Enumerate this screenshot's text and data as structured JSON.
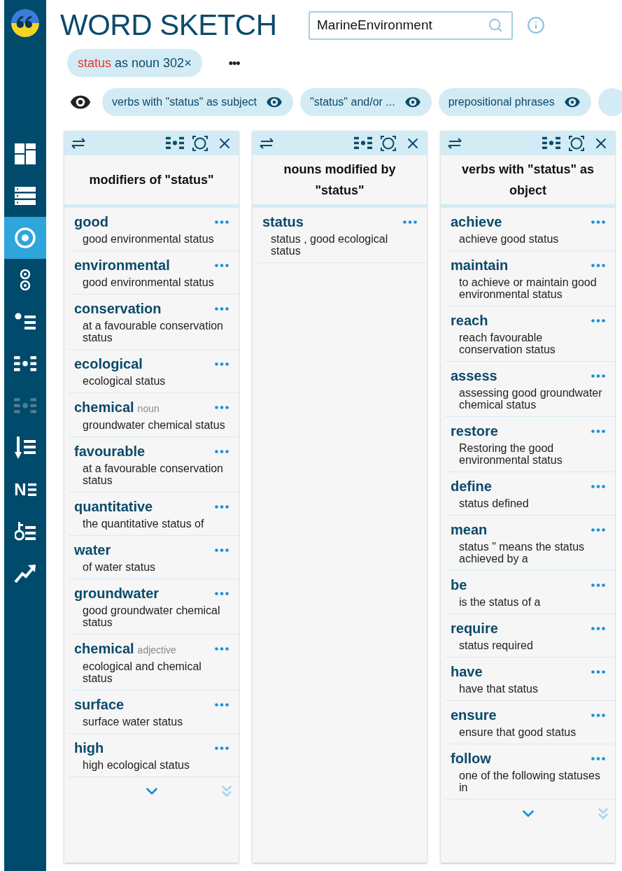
{
  "app": {
    "title": "WORD SKETCH"
  },
  "search": {
    "value": "MarineEnvironment"
  },
  "sidebar": {
    "items": [
      {
        "kind": "dashboard",
        "selected": false,
        "disabled": false
      },
      {
        "kind": "concordance",
        "selected": false,
        "disabled": false
      },
      {
        "kind": "wordsketch",
        "selected": true,
        "disabled": false
      },
      {
        "kind": "difference",
        "selected": false,
        "disabled": false
      },
      {
        "kind": "thesaurus",
        "selected": false,
        "disabled": false
      },
      {
        "kind": "wordlist",
        "selected": false,
        "disabled": false
      },
      {
        "kind": "wordlist",
        "selected": false,
        "disabled": true
      },
      {
        "kind": "sort",
        "selected": false,
        "disabled": false
      },
      {
        "kind": "letters",
        "label": "N",
        "selected": false,
        "disabled": false
      },
      {
        "kind": "keywords",
        "selected": false,
        "disabled": false
      },
      {
        "kind": "trends",
        "selected": false,
        "disabled": false
      }
    ]
  },
  "query": {
    "lemma": "status",
    "rest": "as noun 302×",
    "menu": "•••"
  },
  "chips": [
    {
      "label": "verbs with \"status\" as subject"
    },
    {
      "label": "\"status\" and/or ..."
    },
    {
      "label": "prepositional phrases"
    }
  ],
  "columns": [
    {
      "title": "modifiers of \"status\"",
      "has_more": true,
      "items": [
        {
          "word": "good",
          "example": "good environmental status"
        },
        {
          "word": "environmental",
          "example": "good environmental status"
        },
        {
          "word": "conservation",
          "example": "at a favourable conservation status"
        },
        {
          "word": "ecological",
          "example": "ecological status"
        },
        {
          "word": "chemical",
          "pos": "noun",
          "example": "groundwater chemical status"
        },
        {
          "word": "favourable",
          "example": "at a favourable conservation status"
        },
        {
          "word": "quantitative",
          "example": "the quantitative status of"
        },
        {
          "word": "water",
          "example": "of water status"
        },
        {
          "word": "groundwater",
          "example": "good groundwater chemical status"
        },
        {
          "word": "chemical",
          "pos": "adjective",
          "example": "ecological and chemical status"
        },
        {
          "word": "surface",
          "example": "surface water status"
        },
        {
          "word": "high",
          "example": "high ecological status"
        }
      ]
    },
    {
      "title": "nouns modified by \"status\"",
      "has_more": false,
      "items": [
        {
          "word": "status",
          "example": "status , good ecological status"
        }
      ]
    },
    {
      "title": "verbs with \"status\" as object",
      "has_more": true,
      "items": [
        {
          "word": "achieve",
          "example": "achieve good status"
        },
        {
          "word": "maintain",
          "example": "to achieve or maintain good environmental status"
        },
        {
          "word": "reach",
          "example": "reach favourable conservation status"
        },
        {
          "word": "assess",
          "example": "assessing good groundwater chemical status"
        },
        {
          "word": "restore",
          "example": "Restoring the good environmental status"
        },
        {
          "word": "define",
          "example": "status defined"
        },
        {
          "word": "mean",
          "example": "status \" means the status achieved by a"
        },
        {
          "word": "be",
          "example": "is the status of a"
        },
        {
          "word": "require",
          "example": "status required"
        },
        {
          "word": "have",
          "example": "have that status"
        },
        {
          "word": "ensure",
          "example": "ensure that good status"
        },
        {
          "word": "follow",
          "example": "one of the following statuses in"
        }
      ]
    }
  ]
}
